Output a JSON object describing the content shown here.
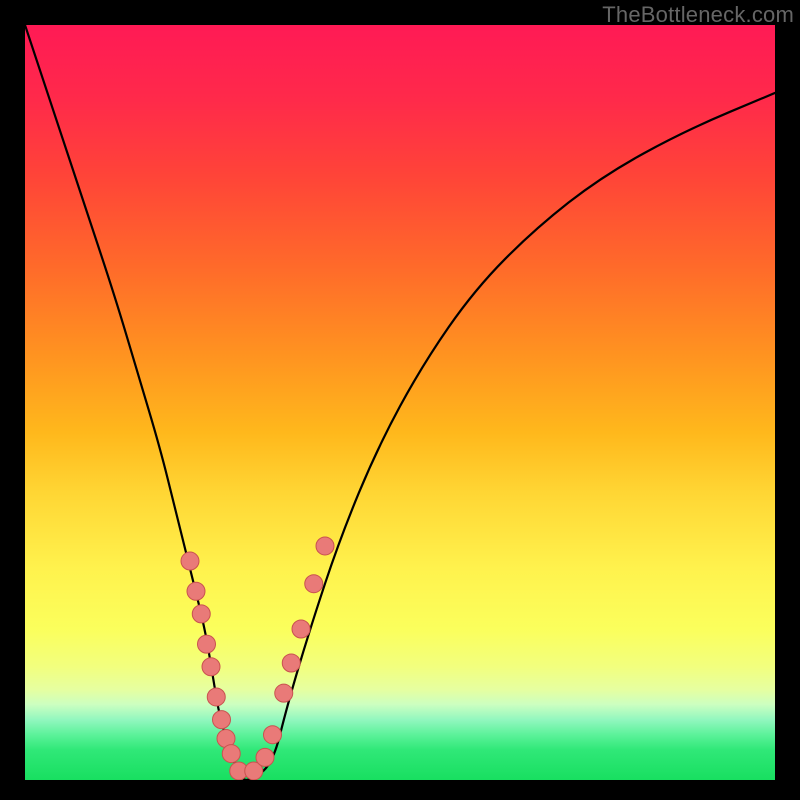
{
  "watermark": "TheBottleneck.com",
  "colors": {
    "curve": "#000000",
    "marker_fill": "#e97a78",
    "marker_stroke": "#c9524f",
    "background_black": "#000000"
  },
  "chart_data": {
    "type": "line",
    "title": "",
    "xlabel": "",
    "ylabel": "",
    "xlim": [
      0,
      100
    ],
    "ylim": [
      0,
      100
    ],
    "grid": false,
    "series": [
      {
        "name": "bottleneck-curve",
        "x": [
          0,
          4,
          8,
          12,
          15,
          18,
          20,
          22,
          24,
          25,
          26,
          28,
          29,
          30,
          33,
          35,
          38,
          42,
          47,
          53,
          60,
          68,
          77,
          88,
          100
        ],
        "values": [
          100,
          88,
          76,
          64,
          54,
          44,
          36,
          28,
          20,
          14,
          8,
          2,
          0,
          0,
          2,
          10,
          20,
          32,
          44,
          55,
          65,
          73,
          80,
          86,
          91
        ]
      }
    ],
    "markers": {
      "name": "highlighted-points",
      "left_branch": [
        {
          "x": 22.0,
          "y": 29
        },
        {
          "x": 22.8,
          "y": 25
        },
        {
          "x": 23.5,
          "y": 22
        },
        {
          "x": 24.2,
          "y": 18
        },
        {
          "x": 24.8,
          "y": 15
        },
        {
          "x": 25.5,
          "y": 11
        },
        {
          "x": 26.2,
          "y": 8
        },
        {
          "x": 26.8,
          "y": 5.5
        },
        {
          "x": 27.5,
          "y": 3.5
        }
      ],
      "bottom": [
        {
          "x": 28.5,
          "y": 1.2
        },
        {
          "x": 30.5,
          "y": 1.2
        }
      ],
      "right_branch": [
        {
          "x": 32.0,
          "y": 3.0
        },
        {
          "x": 33.0,
          "y": 6
        },
        {
          "x": 34.5,
          "y": 11.5
        },
        {
          "x": 35.5,
          "y": 15.5
        },
        {
          "x": 36.8,
          "y": 20
        },
        {
          "x": 38.5,
          "y": 26
        },
        {
          "x": 40.0,
          "y": 31
        }
      ]
    }
  }
}
